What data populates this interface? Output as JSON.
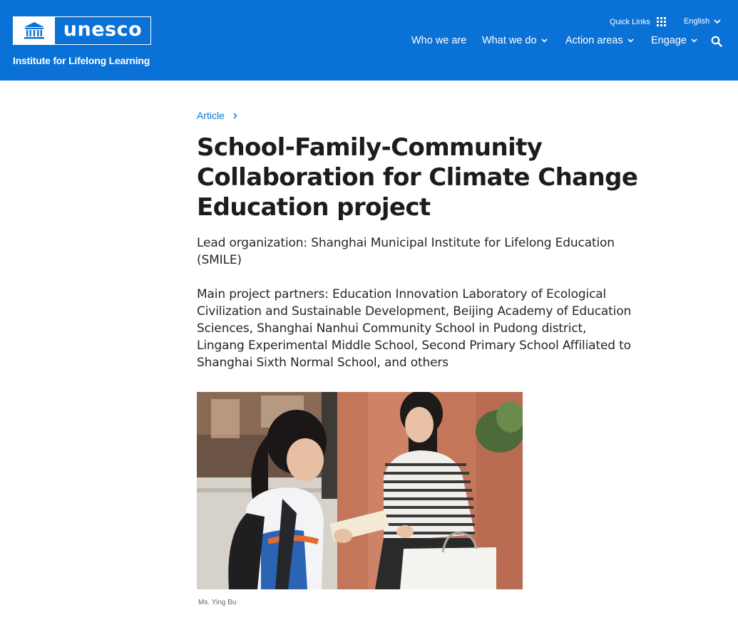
{
  "header": {
    "logo_text": "unesco",
    "institute": "Institute for Lifelong Learning",
    "quick_links": "Quick Links",
    "language": "English",
    "nav": [
      {
        "label": "Who we are",
        "has_dropdown": false
      },
      {
        "label": "What we do",
        "has_dropdown": true
      },
      {
        "label": "Action areas",
        "has_dropdown": true
      },
      {
        "label": "Engage",
        "has_dropdown": true
      }
    ],
    "search_icon": "search-icon",
    "brand_color": "#0a72d6"
  },
  "breadcrumb": {
    "item": "Article"
  },
  "article": {
    "title": "School-Family-Community Collaboration for Climate Change Education project",
    "lead_org": "Lead organization: Shanghai Municipal Institute for Lifelong Education (SMILE)",
    "partners": "Main project partners: Education Innovation Laboratory of Ecological Civilization and Sustainable Development, Beijing Academy of Education Sciences, Shanghai Nanhui Community School in Pudong district, Lingang Experimental Middle School, Second Primary School Affiliated to Shanghai Sixth Normal School, and others",
    "photo_caption": "Ms. Ying Bu"
  }
}
